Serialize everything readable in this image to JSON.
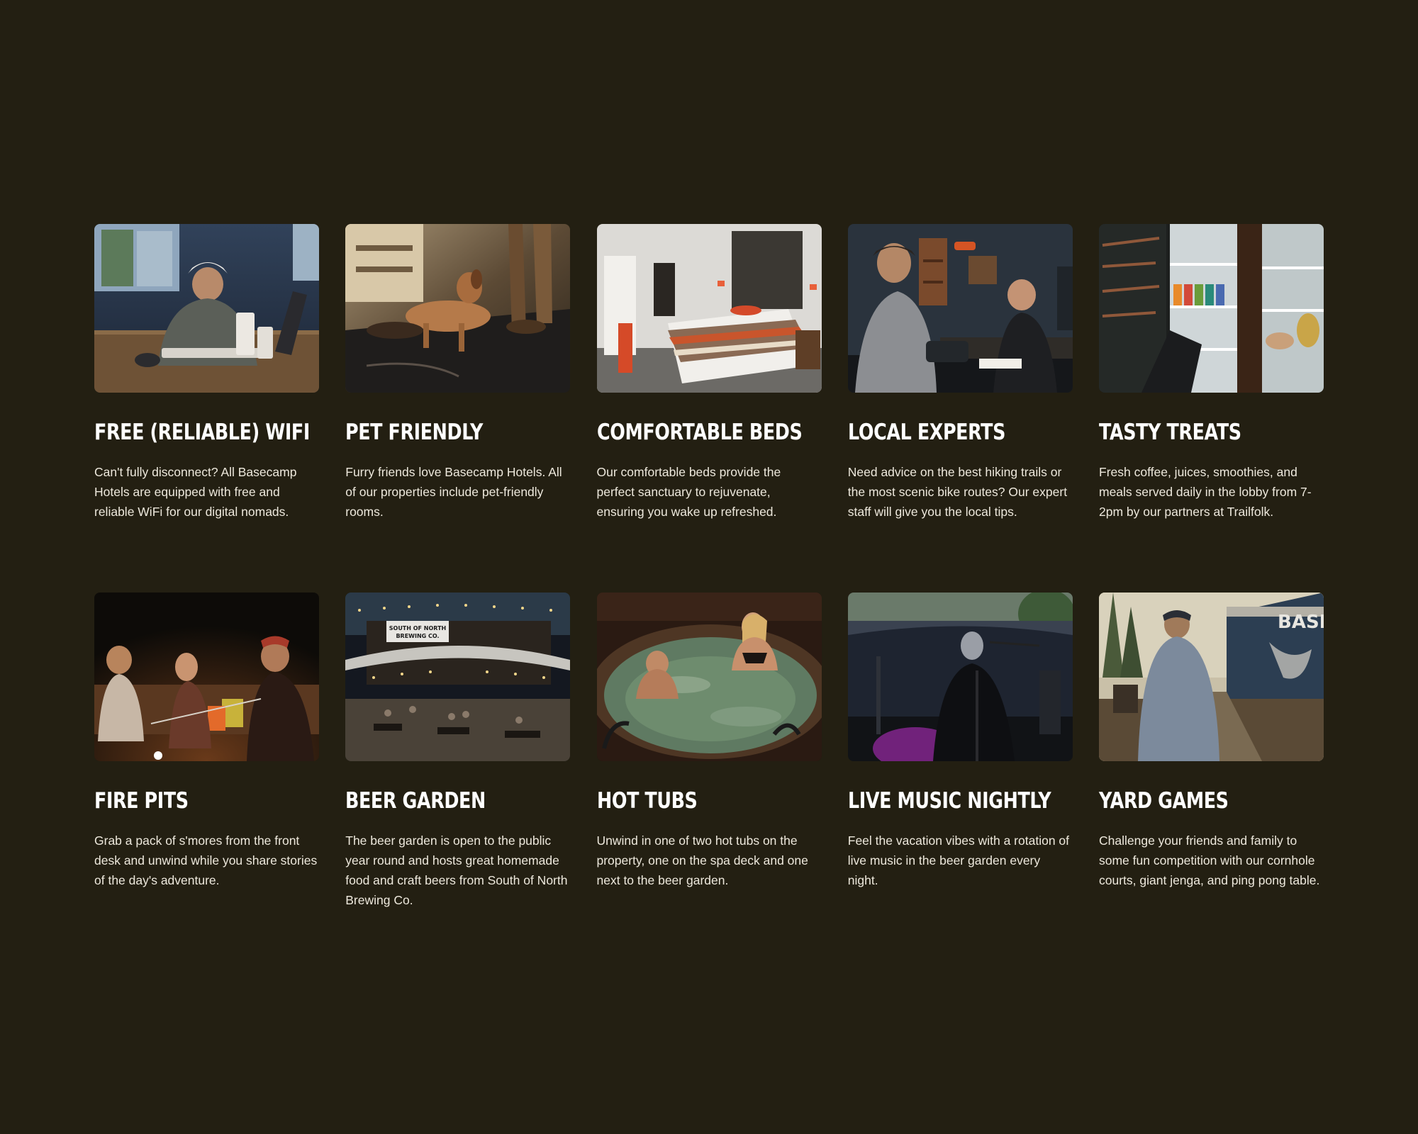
{
  "amenities": [
    {
      "title": "Free (Reliable) WiFi",
      "description": "Can't fully disconnect? All Basecamp Hotels are equipped with free and reliable WiFi for our digital nomads.",
      "photo_icon": "wifi-work-photo"
    },
    {
      "title": "Pet Friendly",
      "description": "Furry friends love Basecamp Hotels. All of our properties include pet-friendly rooms.",
      "photo_icon": "dog-photo"
    },
    {
      "title": "Comfortable Beds",
      "description": "Our comfortable beds provide the perfect sanctuary to rejuvenate, ensuring you wake up refreshed.",
      "photo_icon": "bed-photo"
    },
    {
      "title": "Local Experts",
      "description": "Need advice on the best hiking trails or the most scenic bike routes? Our expert staff will give you the local tips.",
      "photo_icon": "front-desk-photo"
    },
    {
      "title": "Tasty Treats",
      "description": "Fresh coffee, juices, smoothies, and meals served daily in the lobby from 7-2pm by our partners at Trailfolk.",
      "photo_icon": "fridge-photo"
    },
    {
      "title": "Fire Pits",
      "description": "Grab a pack of s'mores from the front desk and unwind while you share stories of the day's adventure.",
      "photo_icon": "fire-pit-photo"
    },
    {
      "title": "Beer Garden",
      "description": "The beer garden is open to the public year round and hosts great homemade food and craft beers from South of North Brewing Co.",
      "photo_icon": "beer-garden-photo",
      "sign_text": [
        "SOUTH OF NORTH",
        "BREWING CO."
      ]
    },
    {
      "title": "Hot Tubs",
      "description": "Unwind in one of two hot tubs on the property, one on the spa deck and one next to the beer garden.",
      "photo_icon": "hot-tub-photo"
    },
    {
      "title": "Live Music Nightly",
      "description": "Feel the vacation vibes with a rotation of live music in the beer garden every night.",
      "photo_icon": "live-music-photo"
    },
    {
      "title": "Yard Games",
      "description": "Challenge your friends and family to some fun competition with our cornhole courts, giant jenga, and ping pong table.",
      "photo_icon": "cornhole-photo",
      "sign_text": "BASE"
    }
  ],
  "colors": {
    "background": "#231f12",
    "heading": "#ffffff",
    "body_text": "#ede8dc"
  }
}
